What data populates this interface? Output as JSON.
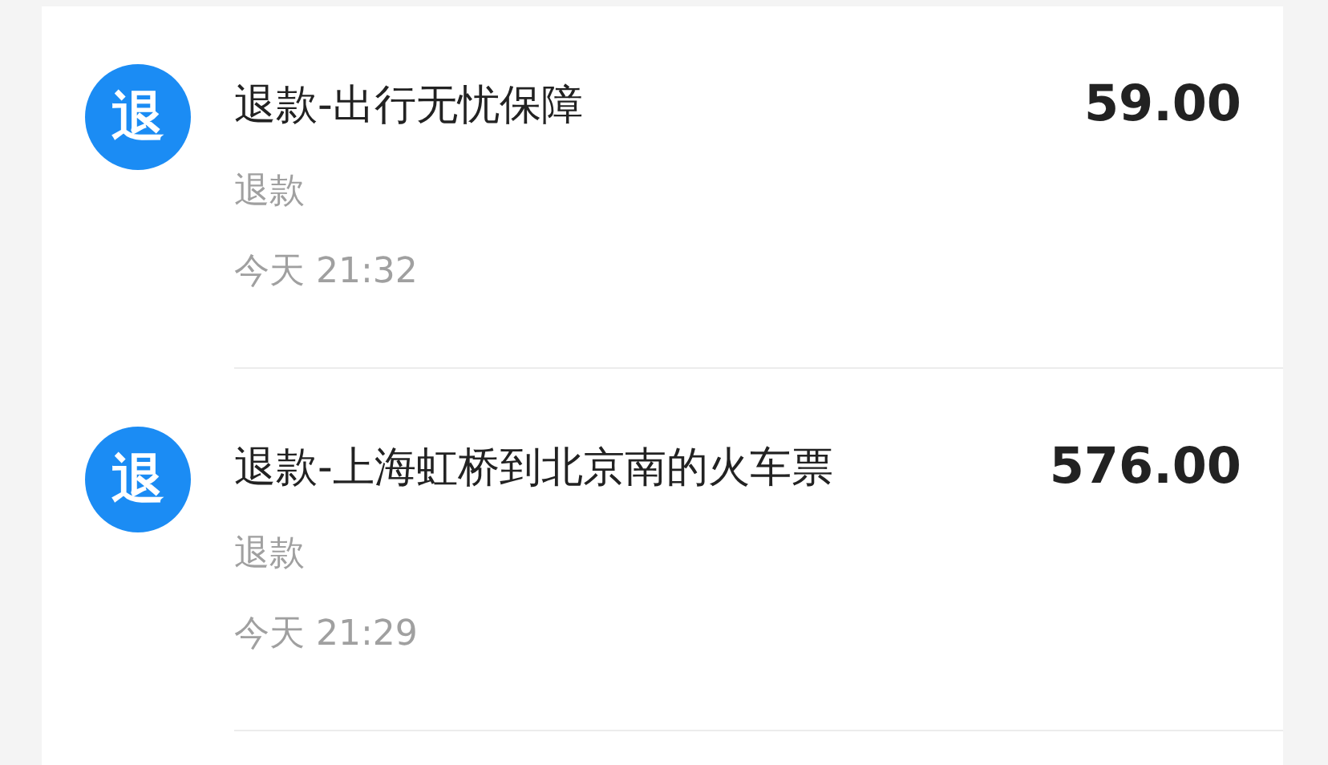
{
  "transactions": [
    {
      "icon": "退",
      "title": "退款-出行无忧保障",
      "amount": "59.00",
      "type": "退款",
      "time": "今天 21:32"
    },
    {
      "icon": "退",
      "title": "退款-上海虹桥到北京南的火车票",
      "amount": "576.00",
      "type": "退款",
      "time": "今天 21:29"
    }
  ]
}
